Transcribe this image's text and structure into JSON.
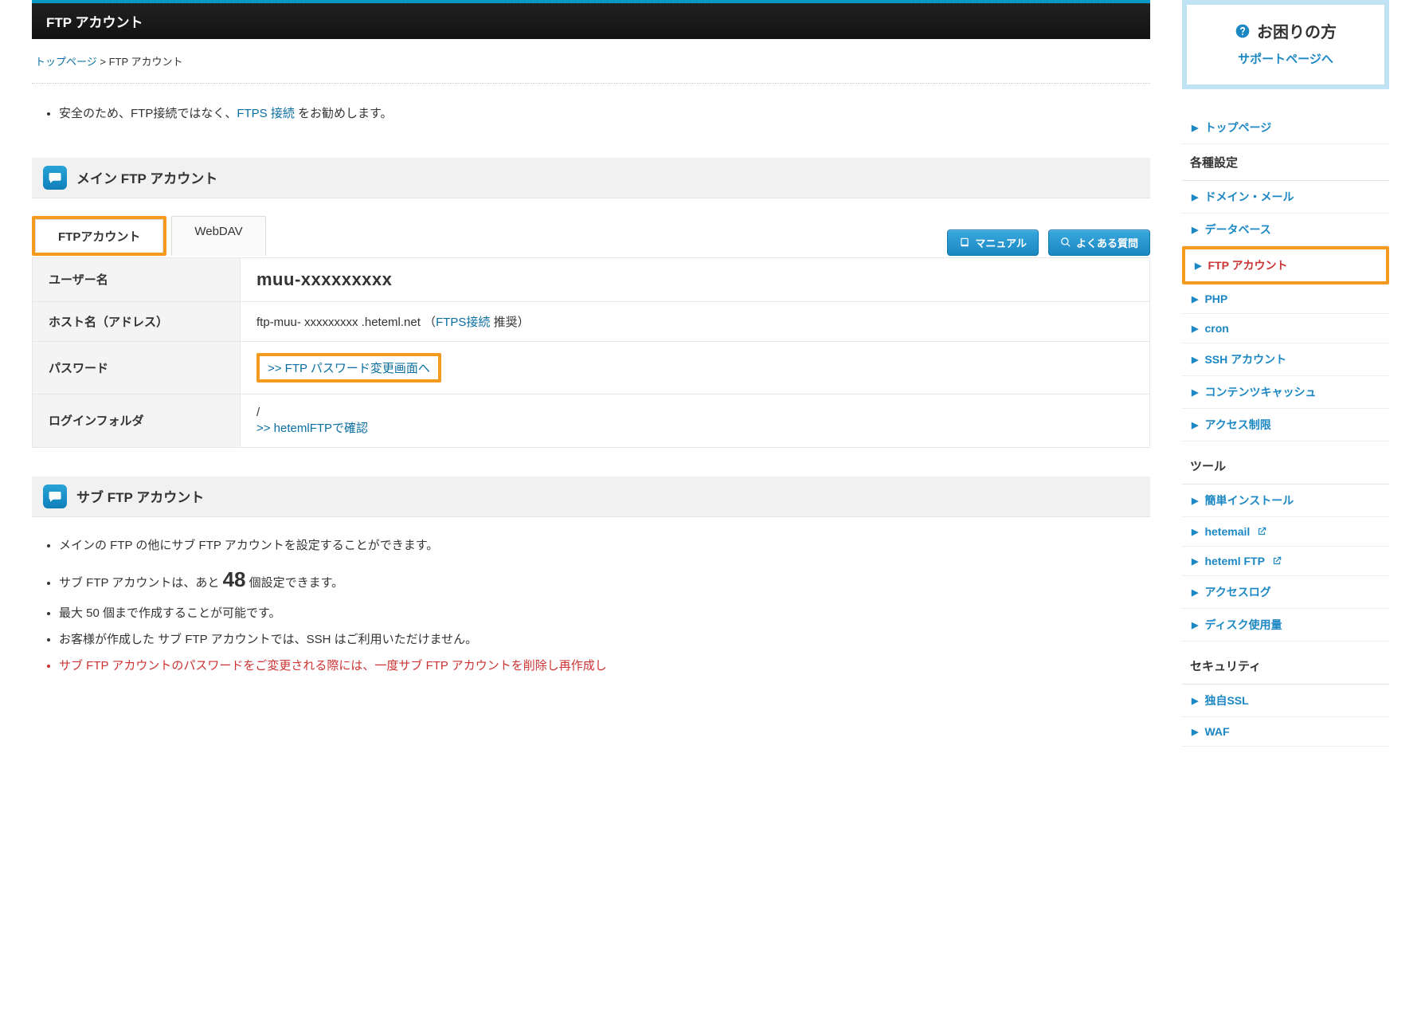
{
  "page_title": "FTP アカウント",
  "breadcrumb": {
    "top_label": "トップページ",
    "sep": ">",
    "current": "FTP アカウント"
  },
  "top_notice": {
    "prefix": "安全のため、FTP接続ではなく、",
    "link": "FTPS 接続",
    "suffix": " をお勧めします。"
  },
  "main_section_title": "メイン FTP アカウント",
  "tabs": {
    "ftp": "FTPアカウント",
    "webdav": "WebDAV"
  },
  "action_buttons": {
    "manual": "マニュアル",
    "faq": "よくある質問"
  },
  "table": {
    "user_label": "ユーザー名",
    "user_value": "muu-xxxxxxxxx",
    "host_label": "ホスト名（アドレス）",
    "host_value_prefix": "ftp-muu- xxxxxxxxx .heteml.net （",
    "host_link": "FTPS接続",
    "host_value_suffix": " 推奨）",
    "pw_label": "パスワード",
    "pw_link": ">> FTP パスワード変更画面へ",
    "folder_label": "ログインフォルダ",
    "folder_value": "/",
    "folder_link": ">> hetemlFTPで確認"
  },
  "sub_section_title": "サブ FTP アカウント",
  "sub_notes": {
    "n1": "メインの FTP の他にサブ FTP アカウントを設定することができます。",
    "n2_prefix": "サブ FTP アカウントは、あと ",
    "n2_big": "48",
    "n2_suffix": " 個設定できます。",
    "n3": "最大 50 個まで作成することが可能です。",
    "n4": "お客様が作成した サブ FTP アカウントでは、SSH はご利用いただけません。",
    "n5": "サブ FTP アカウントのパスワードをご変更される際には、一度サブ FTP アカウントを削除し再作成し"
  },
  "help_box": {
    "title": "お困りの方",
    "link": "サポートページへ"
  },
  "sidebar": {
    "top": "トップページ",
    "sec1_title": "各種設定",
    "sec1_items": [
      {
        "label": "ドメイン・メール"
      },
      {
        "label": "データベース"
      },
      {
        "label": "FTP アカウント",
        "current": true
      },
      {
        "label": "PHP"
      },
      {
        "label": "cron"
      },
      {
        "label": "SSH アカウント"
      },
      {
        "label": "コンテンツキャッシュ"
      },
      {
        "label": "アクセス制限"
      }
    ],
    "sec2_title": "ツール",
    "sec2_items": [
      {
        "label": "簡単インストール"
      },
      {
        "label": "hetemail",
        "ext": true
      },
      {
        "label": "heteml FTP",
        "ext": true
      },
      {
        "label": "アクセスログ"
      },
      {
        "label": "ディスク使用量"
      }
    ],
    "sec3_title": "セキュリティ",
    "sec3_items": [
      {
        "label": "独自SSL"
      },
      {
        "label": "WAF"
      }
    ]
  }
}
